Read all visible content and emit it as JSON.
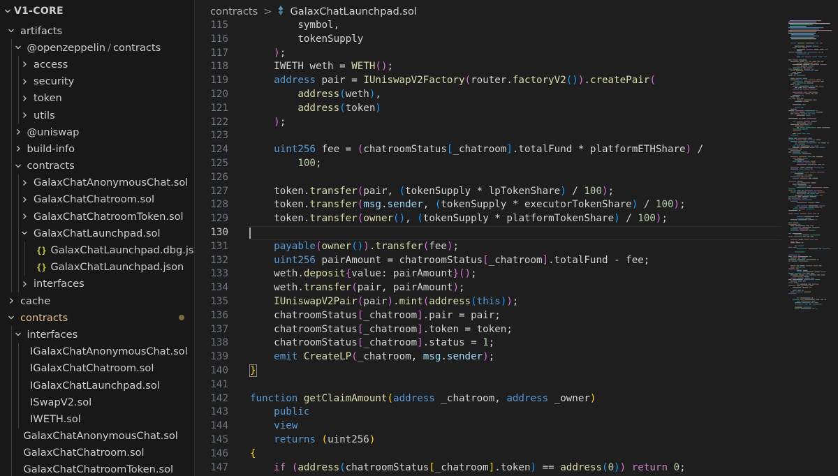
{
  "explorer": {
    "root_label": "V1-CORE",
    "items": [
      {
        "label": "artifacts",
        "kind": "folder",
        "depth": 0,
        "expanded": true
      },
      {
        "label": "@openzeppelin",
        "sep": "/",
        "label2": "contracts",
        "kind": "folder",
        "depth": 1,
        "expanded": true
      },
      {
        "label": "access",
        "kind": "folder",
        "depth": 2,
        "expanded": false
      },
      {
        "label": "security",
        "kind": "folder",
        "depth": 2,
        "expanded": false
      },
      {
        "label": "token",
        "kind": "folder",
        "depth": 2,
        "expanded": false
      },
      {
        "label": "utils",
        "kind": "folder",
        "depth": 2,
        "expanded": false
      },
      {
        "label": "@uniswap",
        "kind": "folder",
        "depth": 1,
        "expanded": false
      },
      {
        "label": "build-info",
        "kind": "folder",
        "depth": 1,
        "expanded": false
      },
      {
        "label": "contracts",
        "kind": "folder",
        "depth": 1,
        "expanded": true
      },
      {
        "label": "GalaxChatAnonymousChat.sol",
        "kind": "folder",
        "depth": 2,
        "expanded": false
      },
      {
        "label": "GalaxChatChatroom.sol",
        "kind": "folder",
        "depth": 2,
        "expanded": false
      },
      {
        "label": "GalaxChatChatroomToken.sol",
        "kind": "folder",
        "depth": 2,
        "expanded": false
      },
      {
        "label": "GalaxChatLaunchpad.sol",
        "kind": "folder",
        "depth": 2,
        "expanded": true
      },
      {
        "label": "GalaxChatLaunchpad.dbg.json",
        "kind": "json",
        "depth": 3
      },
      {
        "label": "GalaxChatLaunchpad.json",
        "kind": "json",
        "depth": 3
      },
      {
        "label": "interfaces",
        "kind": "folder",
        "depth": 2,
        "expanded": false
      },
      {
        "label": "cache",
        "kind": "folder",
        "depth": 0,
        "expanded": false
      },
      {
        "label": "contracts",
        "kind": "folder",
        "depth": 0,
        "expanded": true,
        "modified": true
      },
      {
        "label": "interfaces",
        "kind": "folder",
        "depth": 1,
        "expanded": true
      },
      {
        "label": "IGalaxChatAnonymousChat.sol",
        "kind": "file",
        "depth": 2
      },
      {
        "label": "IGalaxChatChatroom.sol",
        "kind": "file",
        "depth": 2
      },
      {
        "label": "IGalaxChatLaunchpad.sol",
        "kind": "file",
        "depth": 2
      },
      {
        "label": "ISwapV2.sol",
        "kind": "file",
        "depth": 2
      },
      {
        "label": "IWETH.sol",
        "kind": "file",
        "depth": 2
      },
      {
        "label": "GalaxChatAnonymousChat.sol",
        "kind": "file",
        "depth": 1
      },
      {
        "label": "GalaxChatChatroom.sol",
        "kind": "file",
        "depth": 1
      },
      {
        "label": "GalaxChatChatroomToken.sol",
        "kind": "file",
        "depth": 1
      }
    ]
  },
  "breadcrumb": {
    "folder": "contracts",
    "separator": ">",
    "file": "GalaxChatLaunchpad.sol"
  },
  "editor": {
    "current_line": 130,
    "lines": [
      {
        "n": "115",
        "tokens": [
          [
            "        ",
            "text"
          ],
          [
            "symbol",
            "text"
          ],
          [
            ",",
            "text"
          ]
        ]
      },
      {
        "n": "116",
        "tokens": [
          [
            "        ",
            "text"
          ],
          [
            "tokenSupply",
            "text"
          ]
        ]
      },
      {
        "n": "117",
        "tokens": [
          [
            "    ",
            "text"
          ],
          [
            ")",
            "p2"
          ],
          [
            ";",
            "text"
          ]
        ]
      },
      {
        "n": "118",
        "tokens": [
          [
            "    ",
            "text"
          ],
          [
            "IWETH",
            "text"
          ],
          [
            " weth = ",
            "text"
          ],
          [
            "WETH",
            "fn"
          ],
          [
            "()",
            "p2"
          ],
          [
            ";",
            "text"
          ]
        ]
      },
      {
        "n": "119",
        "tokens": [
          [
            "    ",
            "text"
          ],
          [
            "address",
            "kw"
          ],
          [
            " pair = ",
            "text"
          ],
          [
            "IUniswapV2Factory",
            "fn"
          ],
          [
            "(",
            "p2"
          ],
          [
            "router",
            "text"
          ],
          [
            ".",
            "text"
          ],
          [
            "factoryV2",
            "fn"
          ],
          [
            "()",
            "p3"
          ],
          [
            ")",
            "p2"
          ],
          [
            ".",
            "text"
          ],
          [
            "createPair",
            "fn"
          ],
          [
            "(",
            "p2"
          ]
        ]
      },
      {
        "n": "120",
        "tokens": [
          [
            "        ",
            "text"
          ],
          [
            "address",
            "fn"
          ],
          [
            "(",
            "p3"
          ],
          [
            "weth",
            "text"
          ],
          [
            ")",
            "p3"
          ],
          [
            ",",
            "text"
          ]
        ]
      },
      {
        "n": "121",
        "tokens": [
          [
            "        ",
            "text"
          ],
          [
            "address",
            "fn"
          ],
          [
            "(",
            "p3"
          ],
          [
            "token",
            "text"
          ],
          [
            ")",
            "p3"
          ]
        ]
      },
      {
        "n": "122",
        "tokens": [
          [
            "    ",
            "text"
          ],
          [
            ")",
            "p2"
          ],
          [
            ";",
            "text"
          ]
        ]
      },
      {
        "n": "123",
        "tokens": []
      },
      {
        "n": "124",
        "tokens": [
          [
            "    ",
            "text"
          ],
          [
            "uint256",
            "kw"
          ],
          [
            " fee = ",
            "text"
          ],
          [
            "(",
            "p2"
          ],
          [
            "chatroomStatus",
            "text"
          ],
          [
            "[",
            "p3"
          ],
          [
            "_chatroom",
            "text"
          ],
          [
            "]",
            "p3"
          ],
          [
            ".totalFund * platformETHShare",
            "text"
          ],
          [
            ")",
            "p2"
          ],
          [
            " /",
            "text"
          ]
        ]
      },
      {
        "n": "125",
        "tokens": [
          [
            "        ",
            "text"
          ],
          [
            "100",
            "num"
          ],
          [
            ";",
            "text"
          ]
        ]
      },
      {
        "n": "126",
        "tokens": []
      },
      {
        "n": "127",
        "tokens": [
          [
            "    ",
            "text"
          ],
          [
            "token",
            "text"
          ],
          [
            ".",
            "text"
          ],
          [
            "transfer",
            "fn"
          ],
          [
            "(",
            "p2"
          ],
          [
            "pair, ",
            "text"
          ],
          [
            "(",
            "p3"
          ],
          [
            "tokenSupply * lpTokenShare",
            "text"
          ],
          [
            ")",
            "p3"
          ],
          [
            " / ",
            "text"
          ],
          [
            "100",
            "num"
          ],
          [
            ")",
            "p2"
          ],
          [
            ";",
            "text"
          ]
        ]
      },
      {
        "n": "128",
        "tokens": [
          [
            "    ",
            "text"
          ],
          [
            "token",
            "text"
          ],
          [
            ".",
            "text"
          ],
          [
            "transfer",
            "fn"
          ],
          [
            "(",
            "p2"
          ],
          [
            "msg",
            "var"
          ],
          [
            ".",
            "text"
          ],
          [
            "sender",
            "var"
          ],
          [
            ", ",
            "text"
          ],
          [
            "(",
            "p3"
          ],
          [
            "tokenSupply * executorTokenShare",
            "text"
          ],
          [
            ")",
            "p3"
          ],
          [
            " / ",
            "text"
          ],
          [
            "100",
            "num"
          ],
          [
            ")",
            "p2"
          ],
          [
            ";",
            "text"
          ]
        ]
      },
      {
        "n": "129",
        "tokens": [
          [
            "    ",
            "text"
          ],
          [
            "token",
            "text"
          ],
          [
            ".",
            "text"
          ],
          [
            "transfer",
            "fn"
          ],
          [
            "(",
            "p2"
          ],
          [
            "owner",
            "fn"
          ],
          [
            "()",
            "p3"
          ],
          [
            ", ",
            "text"
          ],
          [
            "(",
            "p3"
          ],
          [
            "tokenSupply * platformTokenShare",
            "text"
          ],
          [
            ")",
            "p3"
          ],
          [
            " / ",
            "text"
          ],
          [
            "100",
            "num"
          ],
          [
            ")",
            "p2"
          ],
          [
            ";",
            "text"
          ]
        ]
      },
      {
        "n": "130",
        "tokens": []
      },
      {
        "n": "131",
        "tokens": [
          [
            "    ",
            "text"
          ],
          [
            "payable",
            "kw"
          ],
          [
            "(",
            "p2"
          ],
          [
            "owner",
            "fn"
          ],
          [
            "()",
            "p3"
          ],
          [
            ")",
            "p2"
          ],
          [
            ".",
            "text"
          ],
          [
            "transfer",
            "fn"
          ],
          [
            "(",
            "p2"
          ],
          [
            "fee",
            "text"
          ],
          [
            ")",
            "p2"
          ],
          [
            ";",
            "text"
          ]
        ]
      },
      {
        "n": "132",
        "tokens": [
          [
            "    ",
            "text"
          ],
          [
            "uint256",
            "kw"
          ],
          [
            " pairAmount = chatroomStatus",
            "text"
          ],
          [
            "[",
            "p2"
          ],
          [
            "_chatroom",
            "text"
          ],
          [
            "]",
            "p2"
          ],
          [
            ".totalFund - fee;",
            "text"
          ]
        ]
      },
      {
        "n": "133",
        "tokens": [
          [
            "    ",
            "text"
          ],
          [
            "weth",
            "text"
          ],
          [
            ".",
            "text"
          ],
          [
            "deposit",
            "fn"
          ],
          [
            "{",
            "p2"
          ],
          [
            "value: pairAmount",
            "text"
          ],
          [
            "}",
            "p2"
          ],
          [
            "()",
            "p2"
          ],
          [
            ";",
            "text"
          ]
        ]
      },
      {
        "n": "134",
        "tokens": [
          [
            "    ",
            "text"
          ],
          [
            "weth",
            "text"
          ],
          [
            ".",
            "text"
          ],
          [
            "transfer",
            "fn"
          ],
          [
            "(",
            "p2"
          ],
          [
            "pair, pairAmount",
            "text"
          ],
          [
            ")",
            "p2"
          ],
          [
            ";",
            "text"
          ]
        ]
      },
      {
        "n": "135",
        "tokens": [
          [
            "    ",
            "text"
          ],
          [
            "IUniswapV2Pair",
            "fn"
          ],
          [
            "(",
            "p2"
          ],
          [
            "pair",
            "text"
          ],
          [
            ")",
            "p2"
          ],
          [
            ".",
            "text"
          ],
          [
            "mint",
            "fn"
          ],
          [
            "(",
            "p2"
          ],
          [
            "address",
            "fn"
          ],
          [
            "(",
            "p3"
          ],
          [
            "this",
            "kw"
          ],
          [
            ")",
            "p3"
          ],
          [
            ")",
            "p2"
          ],
          [
            ";",
            "text"
          ]
        ]
      },
      {
        "n": "136",
        "tokens": [
          [
            "    ",
            "text"
          ],
          [
            "chatroomStatus",
            "text"
          ],
          [
            "[",
            "p2"
          ],
          [
            "_chatroom",
            "text"
          ],
          [
            "]",
            "p2"
          ],
          [
            ".pair = pair;",
            "text"
          ]
        ]
      },
      {
        "n": "137",
        "tokens": [
          [
            "    ",
            "text"
          ],
          [
            "chatroomStatus",
            "text"
          ],
          [
            "[",
            "p2"
          ],
          [
            "_chatroom",
            "text"
          ],
          [
            "]",
            "p2"
          ],
          [
            ".token = token;",
            "text"
          ]
        ]
      },
      {
        "n": "138",
        "tokens": [
          [
            "    ",
            "text"
          ],
          [
            "chatroomStatus",
            "text"
          ],
          [
            "[",
            "p2"
          ],
          [
            "_chatroom",
            "text"
          ],
          [
            "]",
            "p2"
          ],
          [
            ".status = ",
            "text"
          ],
          [
            "1",
            "num"
          ],
          [
            ";",
            "text"
          ]
        ]
      },
      {
        "n": "139",
        "tokens": [
          [
            "    ",
            "text"
          ],
          [
            "emit",
            "kw"
          ],
          [
            " ",
            "text"
          ],
          [
            "CreateLP",
            "fn"
          ],
          [
            "(",
            "p2"
          ],
          [
            "_chatroom, ",
            "text"
          ],
          [
            "msg",
            "var"
          ],
          [
            ".",
            "text"
          ],
          [
            "sender",
            "var"
          ],
          [
            ")",
            "p2"
          ],
          [
            ";",
            "text"
          ]
        ]
      },
      {
        "n": "140",
        "tokens": [
          [
            "}",
            "p1"
          ]
        ]
      },
      {
        "n": "141",
        "tokens": []
      },
      {
        "n": "142",
        "tokens": [
          [
            "function",
            "kw"
          ],
          [
            " ",
            "text"
          ],
          [
            "getClaimAmount",
            "fn"
          ],
          [
            "(",
            "p1"
          ],
          [
            "address",
            "kw"
          ],
          [
            " _chatroom, ",
            "text"
          ],
          [
            "address",
            "kw"
          ],
          [
            " _owner",
            "text"
          ],
          [
            ")",
            "p1"
          ]
        ]
      },
      {
        "n": "143",
        "tokens": [
          [
            "    ",
            "text"
          ],
          [
            "public",
            "kw"
          ]
        ]
      },
      {
        "n": "144",
        "tokens": [
          [
            "    ",
            "text"
          ],
          [
            "view",
            "kw"
          ]
        ]
      },
      {
        "n": "145",
        "tokens": [
          [
            "    ",
            "text"
          ],
          [
            "returns",
            "kw"
          ],
          [
            " ",
            "text"
          ],
          [
            "(",
            "p1"
          ],
          [
            "uint256",
            "text"
          ],
          [
            ")",
            "p1"
          ]
        ]
      },
      {
        "n": "146",
        "tokens": [
          [
            "{",
            "p1"
          ]
        ]
      },
      {
        "n": "147",
        "tokens": [
          [
            "    ",
            "text"
          ],
          [
            "if",
            "ctrl"
          ],
          [
            " ",
            "text"
          ],
          [
            "(",
            "p2"
          ],
          [
            "address",
            "fn"
          ],
          [
            "(",
            "p3"
          ],
          [
            "chatroomStatus",
            "text"
          ],
          [
            "[",
            "p1"
          ],
          [
            "_chatroom",
            "text"
          ],
          [
            "]",
            "p1"
          ],
          [
            ".token",
            "text"
          ],
          [
            ")",
            "p3"
          ],
          [
            " == ",
            "text"
          ],
          [
            "address",
            "fn"
          ],
          [
            "(",
            "p3"
          ],
          [
            "0",
            "num"
          ],
          [
            ")",
            "p3"
          ],
          [
            ")",
            "p2"
          ],
          [
            " ",
            "text"
          ],
          [
            "return",
            "ctrl"
          ],
          [
            " ",
            "text"
          ],
          [
            "0",
            "num"
          ],
          [
            ";",
            "text"
          ]
        ]
      }
    ]
  },
  "colors": {
    "folder_modified": "#e2c08d",
    "json_icon": "#cbcb41",
    "solidity_icon": "#519aba"
  }
}
